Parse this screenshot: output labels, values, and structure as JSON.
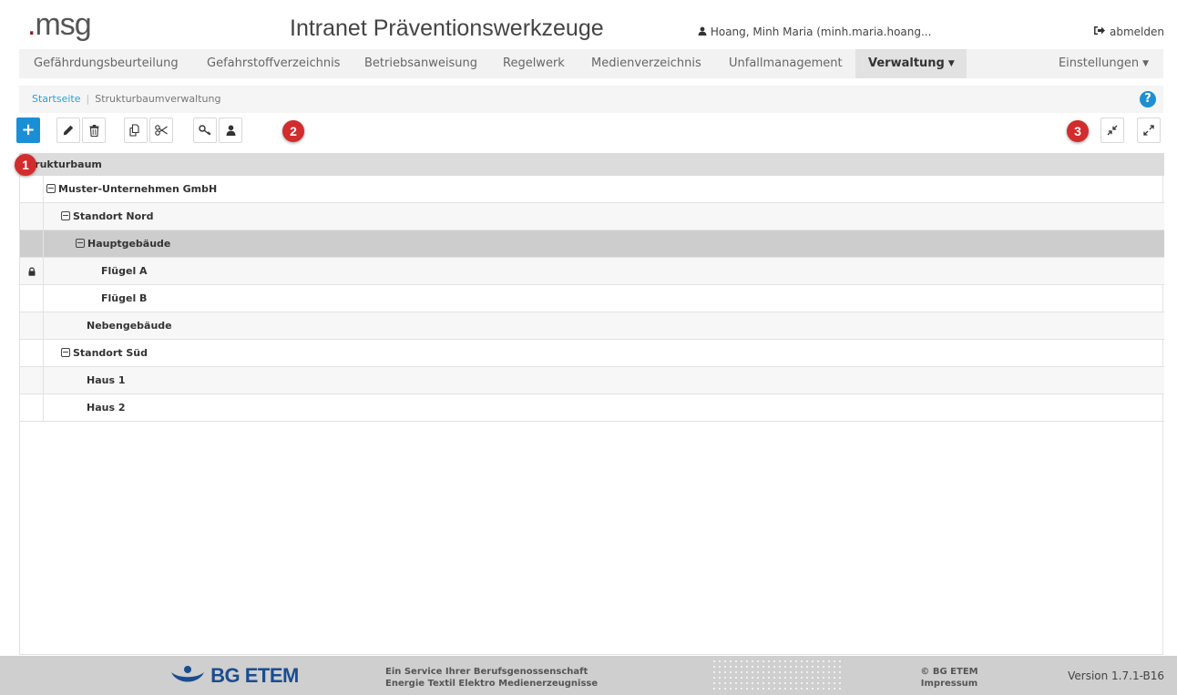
{
  "header": {
    "logo_prefix": ".",
    "logo_text": "msg",
    "title": "Intranet Präventionswerkzeuge",
    "user": "Hoang, Minh Maria (minh.maria.hoang...",
    "logout_label": "abmelden"
  },
  "nav": {
    "items": [
      {
        "label": "Gefährdungsbeurteilung"
      },
      {
        "label": "Gefahrstoffverzeichnis"
      },
      {
        "label": "Betriebsanweisung"
      },
      {
        "label": "Regelwerk"
      },
      {
        "label": "Medienverzeichnis"
      },
      {
        "label": "Unfallmanagement"
      },
      {
        "label": "Verwaltung",
        "active": true,
        "dropdown": true
      }
    ],
    "settings_label": "Einstellungen"
  },
  "breadcrumb": {
    "home": "Startseite",
    "separator": "|",
    "current": "Strukturbaumverwaltung"
  },
  "help": {
    "label": "?"
  },
  "toolbar": {
    "buttons": [
      {
        "name": "add",
        "icon": "plus-icon",
        "glyph": "+"
      },
      {
        "name": "edit",
        "icon": "pencil-icon"
      },
      {
        "name": "delete",
        "icon": "trash-icon"
      },
      {
        "name": "copy",
        "icon": "copy-icon"
      },
      {
        "name": "cut",
        "icon": "scissors-icon"
      },
      {
        "name": "key",
        "icon": "key-icon"
      },
      {
        "name": "user",
        "icon": "user-icon"
      }
    ],
    "right_buttons": [
      {
        "name": "collapse",
        "icon": "compress-icon"
      },
      {
        "name": "expand",
        "icon": "expand-icon"
      }
    ]
  },
  "markers": [
    "1",
    "2",
    "3"
  ],
  "tree": {
    "header": "Strukturbaum",
    "rows": [
      {
        "label": "Muster-Unternehmen GmbH",
        "level": 0,
        "expandable": true
      },
      {
        "label": "Standort Nord",
        "level": 1,
        "expandable": true
      },
      {
        "label": "Hauptgebäude",
        "level": 2,
        "expandable": true,
        "selected": true
      },
      {
        "label": "Flügel A",
        "level": 3,
        "expandable": false,
        "locked": true
      },
      {
        "label": "Flügel B",
        "level": 3,
        "expandable": false
      },
      {
        "label": "Nebengebäude",
        "level": 2,
        "expandable": false
      },
      {
        "label": "Standort Süd",
        "level": 1,
        "expandable": true
      },
      {
        "label": "Haus 1",
        "level": 2,
        "expandable": false
      },
      {
        "label": "Haus 2",
        "level": 2,
        "expandable": false
      }
    ]
  },
  "footer": {
    "brand": "BG ETEM",
    "service_line1": "Ein Service Ihrer Berufsgenossenschaft",
    "service_line2": "Energie Textil Elektro Medienerzeugnisse",
    "copyright": "© BG ETEM",
    "impressum": "Impressum",
    "version": "Version 1.7.1-B16"
  },
  "colors": {
    "primary": "#1b8fd6",
    "marker": "#d22c2c",
    "link": "#2aa0dd",
    "brand_blue": "#1a4d8f",
    "logo_dot": "#8b1a2b"
  }
}
